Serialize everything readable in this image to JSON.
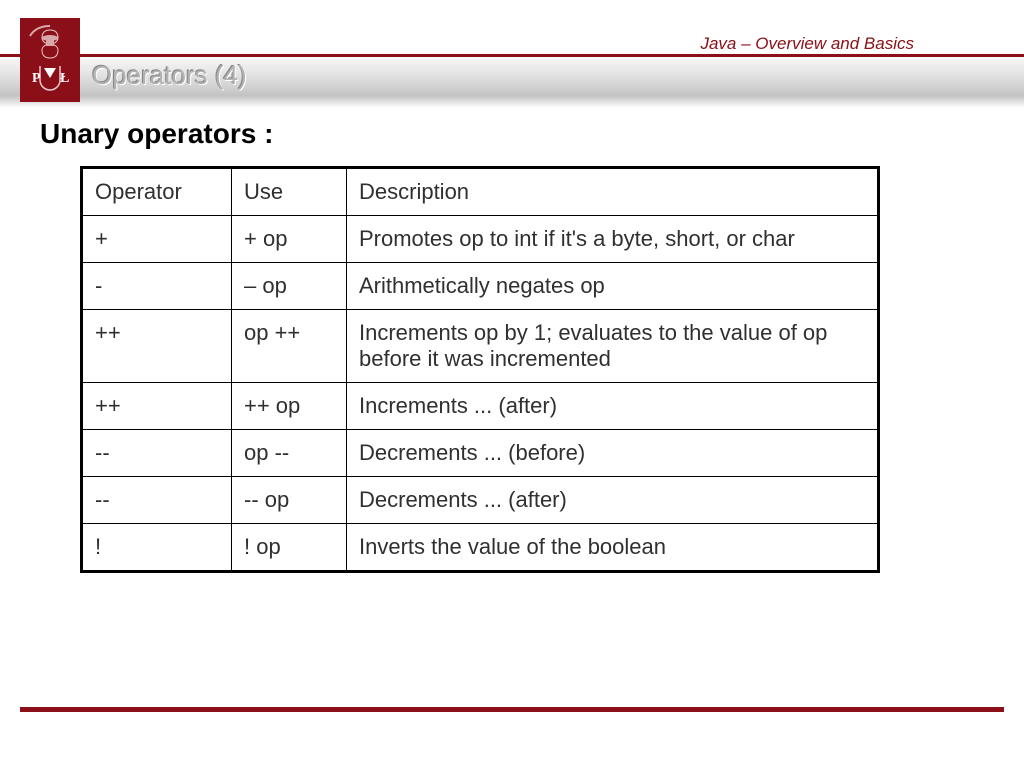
{
  "header": {
    "course_label": "Java – Overview and Basics",
    "slide_title": "Operators (4)"
  },
  "section": {
    "heading": "Unary operators :"
  },
  "table": {
    "headers": [
      "Operator",
      "Use",
      "Description"
    ],
    "rows": [
      {
        "operator": "+",
        "use": "+ op",
        "description": "Promotes op to int if it's a byte, short, or char"
      },
      {
        "operator": "-",
        "use": "– op",
        "description": "Arithmetically negates op"
      },
      {
        "operator": "++",
        "use": "op ++",
        "description": "Increments op by 1; evaluates to the value of op before it was incremented"
      },
      {
        "operator": "++",
        "use": "++ op",
        "description": "Increments ... (after)"
      },
      {
        "operator": "--",
        "use": "op --",
        "description": "Decrements ... (before)"
      },
      {
        "operator": "--",
        "use": "-- op",
        "description": "Decrements ... (after)"
      },
      {
        "operator": "!",
        "use": "! op",
        "description": "Inverts the value of the boolean"
      }
    ]
  }
}
